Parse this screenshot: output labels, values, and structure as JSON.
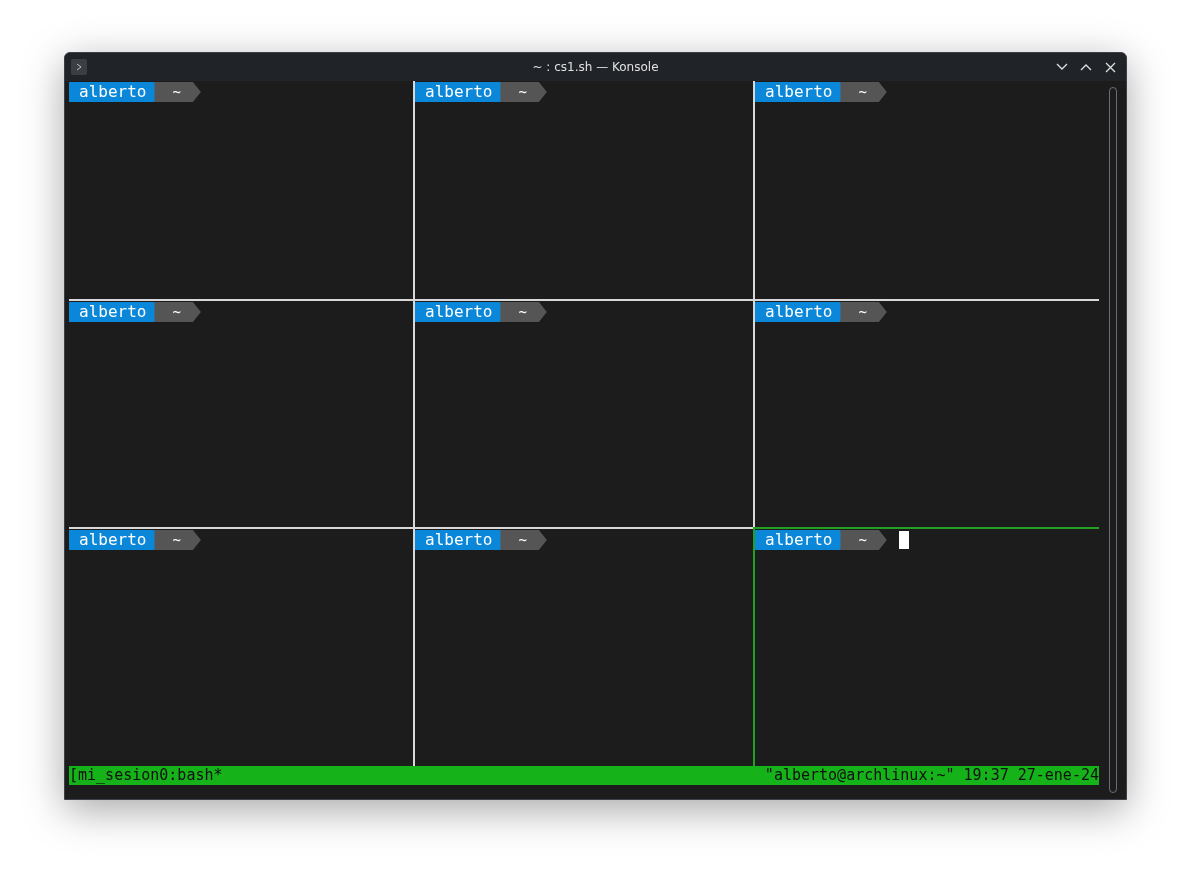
{
  "window": {
    "title": "~ : cs1.sh — Konsole"
  },
  "panes": [
    {
      "user": "alberto",
      "dir": "~",
      "selected": false
    },
    {
      "user": "alberto",
      "dir": "~",
      "selected": false
    },
    {
      "user": "alberto",
      "dir": "~",
      "selected": false
    },
    {
      "user": "alberto",
      "dir": "~",
      "selected": false
    },
    {
      "user": "alberto",
      "dir": "~",
      "selected": false
    },
    {
      "user": "alberto",
      "dir": "~",
      "selected": false
    },
    {
      "user": "alberto",
      "dir": "~",
      "selected": false
    },
    {
      "user": "alberto",
      "dir": "~",
      "selected": false
    },
    {
      "user": "alberto",
      "dir": "~",
      "selected": true
    }
  ],
  "status_bar": {
    "left": "[mi_sesion0:bash*",
    "right": "\"alberto@archlinux:~\" 19:37 27-ene-24"
  }
}
